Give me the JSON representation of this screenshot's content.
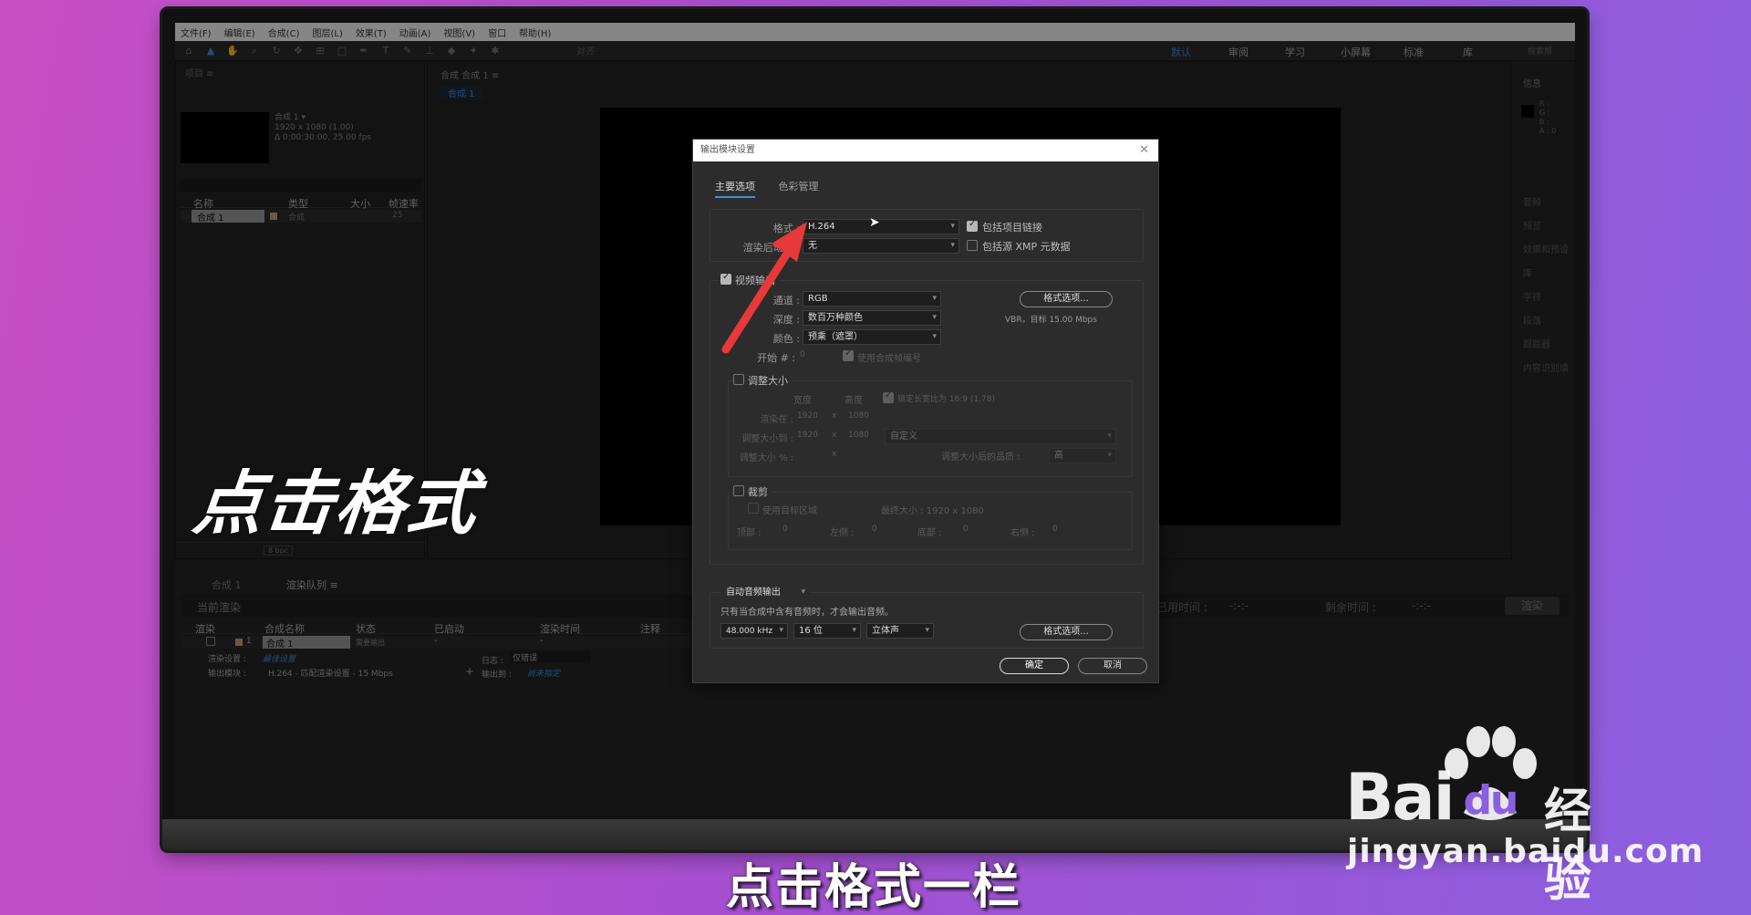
{
  "menu": [
    "文件(F)",
    "编辑(E)",
    "合成(C)",
    "图层(L)",
    "效果(T)",
    "动画(A)",
    "视图(V)",
    "窗口",
    "帮助(H)"
  ],
  "toolbar": {
    "snap_label": "对齐"
  },
  "workspaces": [
    {
      "label": "默认",
      "active": true
    },
    {
      "label": "审阅"
    },
    {
      "label": "学习"
    },
    {
      "label": "小屏幕"
    },
    {
      "label": "标准"
    },
    {
      "label": "库"
    }
  ],
  "search_help": "搜索帮",
  "project": {
    "title": "项目 ≡",
    "comp_name": "合成 1 ▾",
    "comp_size": "1920 x 1080 (1.00)",
    "comp_duration": "Δ 0:00:30:00, 25.00 fps",
    "columns": [
      "名称",
      "类型",
      "大小",
      "帧速率"
    ],
    "item": {
      "name": "合成 1",
      "type": "合成",
      "fps": "25"
    },
    "bpc": "8 bpc"
  },
  "composition": {
    "tab": "合成 合成 1 ≡",
    "subtab": "合成 1"
  },
  "right_panel": {
    "info_title": "信息",
    "rgb": [
      "R :",
      "G :",
      "B :",
      "A : 0"
    ],
    "items": [
      "音频",
      "预览",
      "效果和预设",
      "库",
      "字符",
      "段落",
      "跟踪器",
      "内容识别填"
    ]
  },
  "bottom": {
    "tabs": [
      "合成 1",
      "渲染队列 ≡"
    ],
    "current_render": "当前渲染",
    "elapsed": "已用时间 :",
    "remaining": "剩余时间 :",
    "dashes": "-:-:-",
    "render_btn": "渲染",
    "columns": [
      "渲染",
      "合成名称",
      "状态",
      "已启动",
      "渲染时间",
      "注释"
    ],
    "row": {
      "num": "1",
      "comp": "合成 1",
      "status": "需要输出",
      "started": "-",
      "time": "-"
    },
    "render_settings_label": "渲染设置 :",
    "render_settings_value": "最佳设置",
    "output_module_label": "输出模块 :",
    "output_module_value": "H.264 - 匹配渲染设置 - 15 Mbps",
    "log_label": "日志 :",
    "log_value": "仅错误",
    "output_to_label": "输出到 :",
    "output_to_value": "尚未指定"
  },
  "dialog": {
    "title": "输出模块设置",
    "tabs": [
      "主要选项",
      "色彩管理"
    ],
    "format_label": "格式 :",
    "format_value": "H.264",
    "post_render_label": "渲染后动作 :",
    "post_render_value": "无",
    "include_link": "包括项目链接",
    "include_xmp": "包括源 XMP 元数据",
    "video_output": "视频输出",
    "channels_label": "通道 :",
    "channels_value": "RGB",
    "depth_label": "深度 :",
    "depth_value": "数百万种颜色",
    "color_label": "颜色 :",
    "color_value": "预乘（遮罩）",
    "start_label": "开始 # :",
    "start_value": "0",
    "use_comp_frame": "使用合成帧编号",
    "format_options": "格式选项...",
    "vbr_info": "VBR，目标 15.00 Mbps",
    "resize": "调整大小",
    "width": "宽度",
    "height": "高度",
    "lock_aspect": "锁定长宽比为 16:9 (1.78)",
    "rendering_at": "渲染在 :",
    "resize_to": "调整大小到 :",
    "resize_pct": "调整大小 % :",
    "w1920": "1920",
    "h1080": "1080",
    "x": "x",
    "custom": "自定义",
    "resize_quality": "调整大小后的品质 :",
    "quality_value": "高",
    "crop": "裁剪",
    "use_roi": "使用目标区域",
    "final_size": "最终大小 : 1920 x 1080",
    "top": "顶部 :",
    "left": "左侧 :",
    "bottom": "底部 :",
    "right": "右侧 :",
    "zero": "0",
    "auto_audio": "自动音频输出",
    "audio_note": "只有当合成中含有音频时，才会输出音频。",
    "sample_rate": "48.000 kHz",
    "bits": "16 位",
    "stereo": "立体声",
    "audio_format_options": "格式选项...",
    "ok": "确定",
    "cancel": "取消"
  },
  "overlay_text": "点击格式",
  "subtitle": "点击格式一栏",
  "watermark": {
    "brand": "Bai",
    "brand2": "du",
    "product": "经验",
    "url": "jingyan.baidu.com"
  },
  "colors": {
    "accent": "#3d8fe0",
    "arrow": "#e8383a"
  }
}
